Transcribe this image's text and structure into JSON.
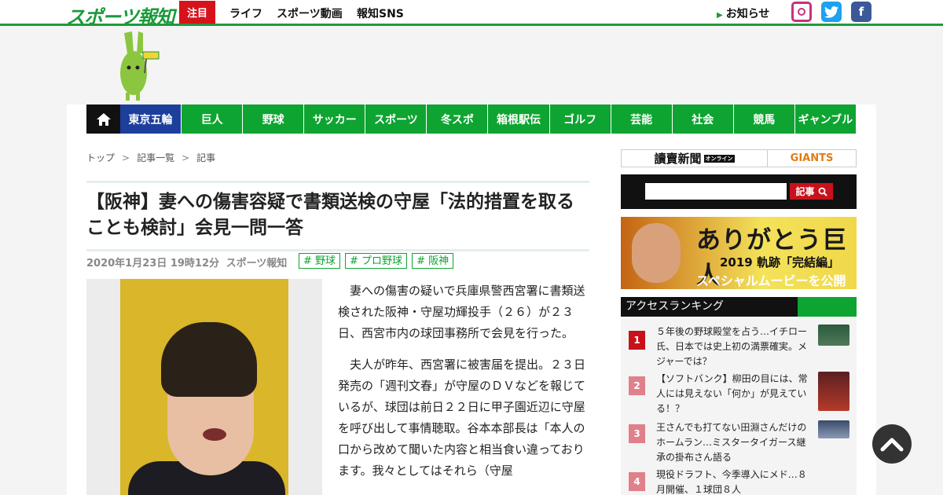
{
  "site": {
    "logo": "スポーツ報知"
  },
  "topnav": {
    "hot_label": "注目",
    "links": [
      "ライフ",
      "スポーツ動画",
      "報知SNS"
    ],
    "notice": "お知らせ",
    "sns": [
      "instagram-icon",
      "twitter-icon",
      "facebook-icon"
    ]
  },
  "gnav": {
    "home_icon": "home-icon",
    "items": [
      "東京五輪",
      "巨人",
      "野球",
      "サッカー",
      "スポーツ",
      "冬スポ",
      "箱根駅伝",
      "ゴルフ",
      "芸能",
      "社会",
      "競馬",
      "ギャンブル"
    ]
  },
  "breadcrumb": [
    "トップ",
    "記事一覧",
    "記事"
  ],
  "article": {
    "headline": "【阪神】妻への傷害容疑で書類送検の守屋「法的措置を取ることも検討」会見一問一答",
    "date": "2020年1月23日 19時12分",
    "source": "スポーツ報知",
    "tags": [
      "# 野球",
      "# プロ野球",
      "# 阪神"
    ],
    "paragraphs": [
      "妻への傷害の疑いで兵庫県警西宮署に書類送検された阪神・守屋功輝投手（２６）が２３日、西宮市内の球団事務所で会見を行った。",
      "夫人が昨年、西宮署に被害届を提出。２３日発売の「週刊文春」が守屋のＤＶなどを報じているが、球団は前日２２日に甲子園近辺に守屋を呼び出して事情聴取。谷本本部長は「本人の口から改めて聞いた内容と相当食い違っております。我々としてはそれら（守屋"
    ]
  },
  "sidebar": {
    "brand_left": "讀賣新聞",
    "brand_left_sub": "オンライン",
    "brand_right": "GIANTS",
    "search_button": "記事",
    "banner": {
      "title": "ありがとう巨人",
      "subtitle": "2019 軌跡「完結編」",
      "caption": "スペシャルムービーを公開"
    },
    "ranking_title": "アクセスランキング",
    "ranking": [
      {
        "rank": "1",
        "text": "５年後の野球殿堂を占う…イチロー氏、日本では史上初の満票確実。メジャーでは？"
      },
      {
        "rank": "2",
        "text": "【ソフトバンク】柳田の目には、常人には見えない「何か」が見えている！？"
      },
      {
        "rank": "3",
        "text": "王さんでも打てない田淵さんだけのホームラン…ミスタータイガース継承の掛布さん語る"
      },
      {
        "rank": "4",
        "text": "現役ドラフト、今季導入にメド…８月開催、１球団８人"
      }
    ]
  },
  "colors": {
    "brand_green": "#0ea431",
    "olympic_blue": "#1d3f9c",
    "hot_red": "#d6131b",
    "rank1": "#c8121b",
    "rank_other": "#e0808a"
  },
  "back_to_top_icon": "chevron-up-icon"
}
